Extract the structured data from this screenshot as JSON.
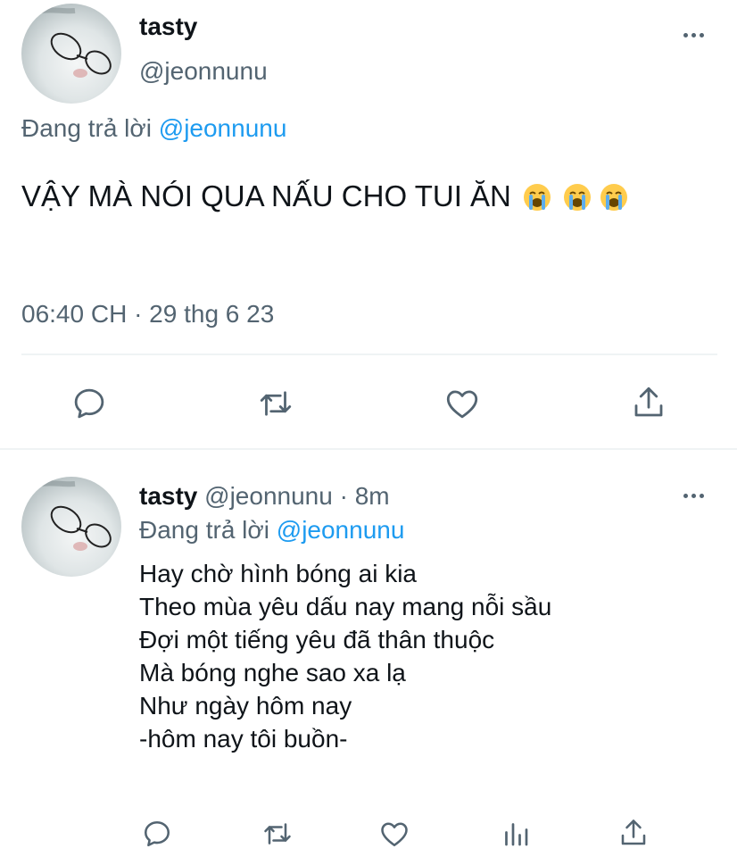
{
  "main_tweet": {
    "display_name": "tasty",
    "handle": "@jeonnunu",
    "reply_prefix": "Đang trả lời",
    "reply_to": "@jeonnunu",
    "text": "VẬY MÀ NÓI QUA NẤU CHO TUI ĂN",
    "timestamp": "06:40 CH · 29 thg 6 23"
  },
  "reply_tweet": {
    "display_name": "tasty",
    "meta": "@jeonnunu · 8m",
    "reply_prefix": "Đang trả lời",
    "reply_to": "@jeonnunu",
    "lines": [
      "Hay chờ hình bóng ai kia",
      "Theo mùa yêu dấu nay mang nỗi sầu",
      "Đợi một tiếng yêu đã thân thuộc",
      "Mà bóng nghe sao xa lạ",
      "Như ngày hôm nay",
      "-hôm nay tôi buồn-"
    ]
  },
  "icons": {
    "more": "more-horizontal-icon",
    "reply": "reply-icon",
    "retweet": "retweet-icon",
    "like": "heart-icon",
    "share": "share-icon",
    "views": "analytics-icon",
    "emoji": "loudly-crying-face-emoji"
  },
  "colors": {
    "text": "#0f1419",
    "muted": "#536471",
    "link": "#1d9bf0",
    "divider": "#eff3f4"
  }
}
